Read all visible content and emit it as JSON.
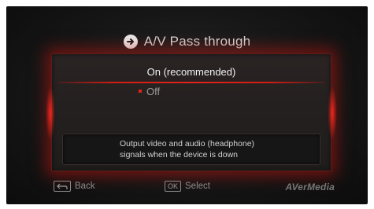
{
  "header": {
    "title": "A/V Pass through"
  },
  "menu": {
    "options": [
      {
        "label": "On (recommended)",
        "selected": true
      },
      {
        "label": "Off",
        "selected": false
      }
    ]
  },
  "description": {
    "line1": "Output video and audio (headphone)",
    "line2": "signals when the device is down"
  },
  "footer": {
    "back_label": "Back",
    "ok_key": "OK",
    "select_label": "Select",
    "brand": "AVerMedia"
  },
  "icons": {
    "title": "arrow-circle-icon",
    "back": "back-arrow-key-icon"
  },
  "colors": {
    "accent": "#e0241a",
    "background": "#161616"
  }
}
